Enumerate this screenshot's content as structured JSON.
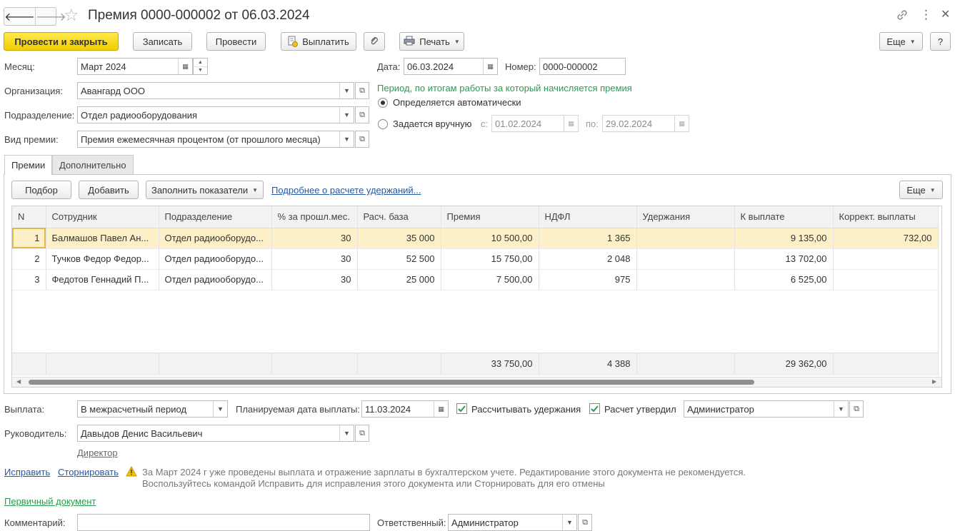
{
  "window": {
    "title": "Премия 0000-000002 от 06.03.2024"
  },
  "toolbar": {
    "post_close": "Провести и закрыть",
    "save": "Записать",
    "post": "Провести",
    "pay": "Выплатить",
    "print": "Печать",
    "more": "Еще",
    "help": "?"
  },
  "header": {
    "month_label": "Месяц:",
    "month_value": "Март 2024",
    "org_label": "Организация:",
    "org_value": "Авангард ООО",
    "dept_label": "Подразделение:",
    "dept_value": "Отдел радиооборудования",
    "bonus_type_label": "Вид премии:",
    "bonus_type_value": "Премия ежемесячная процентом (от прошлого месяца)",
    "date_label": "Дата:",
    "date_value": "06.03.2024",
    "number_label": "Номер:",
    "number_value": "0000-000002",
    "period_title": "Период, по итогам работы за который начисляется премия",
    "radio_auto": "Определяется автоматически",
    "radio_manual": "Задается вручную",
    "from_label": "с:",
    "from_value": "01.02.2024",
    "to_label": "по:",
    "to_value": "29.02.2024"
  },
  "tabs": {
    "bonuses": "Премии",
    "additional": "Дополнительно"
  },
  "table_toolbar": {
    "pick": "Подбор",
    "add": "Добавить",
    "fill": "Заполнить показатели",
    "details_link": "Подробнее о расчете удержаний...",
    "more": "Еще"
  },
  "table": {
    "columns": [
      "N",
      "Сотрудник",
      "Подразделение",
      "% за прошл.мес.",
      "Расч. база",
      "Премия",
      "НДФЛ",
      "Удержания",
      "К выплате",
      "Коррект. выплаты"
    ],
    "rows": [
      [
        "1",
        "Балмашов Павел Ан...",
        "Отдел радиооборудо...",
        "30",
        "35 000",
        "10 500,00",
        "1 365",
        "",
        "9 135,00",
        "732,00"
      ],
      [
        "2",
        "Тучков Федор Федор...",
        "Отдел радиооборудо...",
        "30",
        "52 500",
        "15 750,00",
        "2 048",
        "",
        "13 702,00",
        ""
      ],
      [
        "3",
        "Федотов Геннадий П...",
        "Отдел радиооборудо...",
        "30",
        "25 000",
        "7 500,00",
        "975",
        "",
        "6 525,00",
        ""
      ]
    ],
    "totals": [
      "",
      "",
      "",
      "",
      "",
      "33 750,00",
      "4 388",
      "",
      "29 362,00",
      ""
    ]
  },
  "footer": {
    "payment_label": "Выплата:",
    "payment_value": "В межрасчетный период",
    "planned_date_label": "Планируемая дата выплаты:",
    "planned_date_value": "11.03.2024",
    "calc_deductions": "Рассчитывать удержания",
    "calc_approved": "Расчет утвердил",
    "approver_value": "Администратор",
    "manager_label": "Руководитель:",
    "manager_value": "Давыдов Денис Васильевич",
    "manager_position": "Директор",
    "fix_link": "Исправить",
    "reverse_link": "Сторнировать",
    "warning_line1": "За Март 2024 г уже проведены выплата и отражение зарплаты в бухгалтерском учете. Редактирование этого документа не рекомендуется.",
    "warning_line2": "Воспользуйтесь командой Исправить для исправления этого документа или Сторнировать для его отмены",
    "primary_doc_link": "Первичный документ",
    "comment_label": "Комментарий:",
    "comment_value": "",
    "responsible_label": "Ответственный:",
    "responsible_value": "Администратор"
  },
  "colors": {
    "primary_button": "#f2cd00",
    "link": "#2459a8",
    "green_text": "#2b9a52",
    "selected_row": "#fbf0c8",
    "warning": "#e6b400"
  }
}
